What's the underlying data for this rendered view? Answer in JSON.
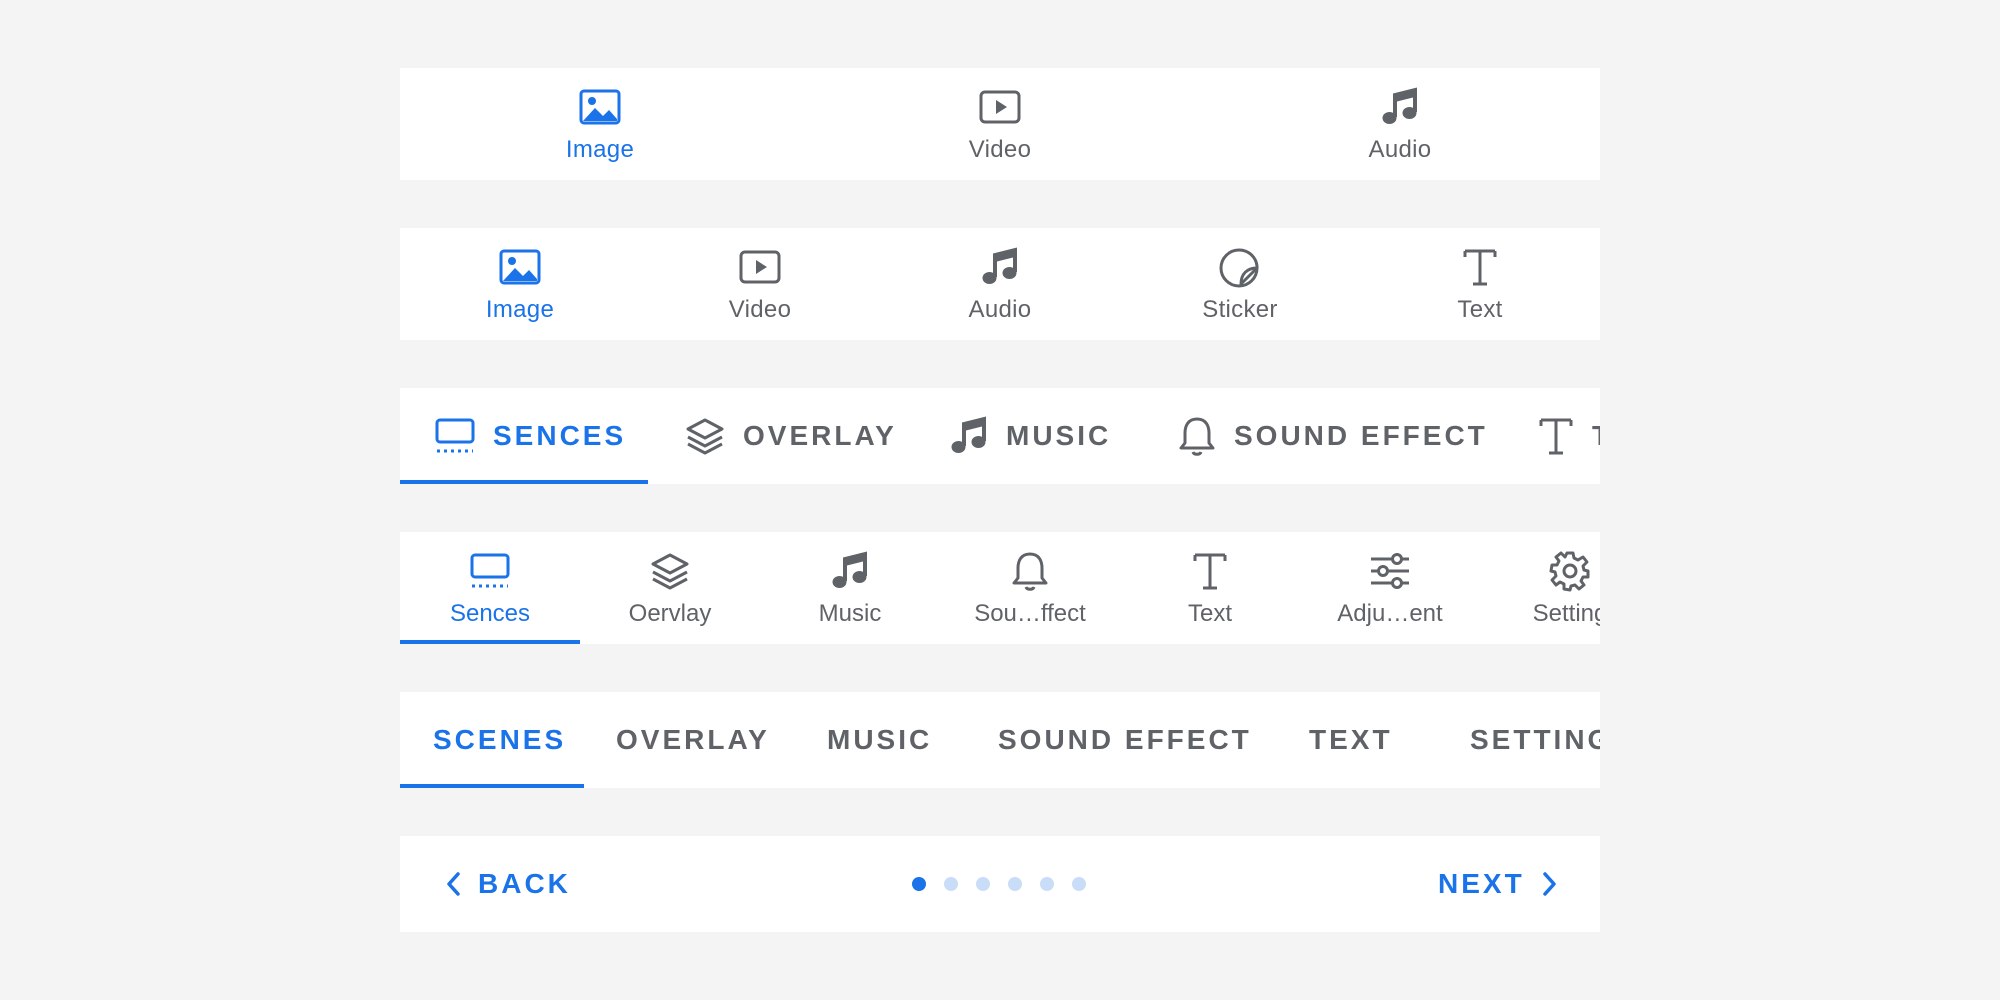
{
  "colors": {
    "accent": "#1a73e8",
    "inactive": "#5f6368",
    "dot_inactive": "#c9dcf8",
    "background": "#f4f4f4",
    "surface": "#ffffff"
  },
  "bottom_nav_3": {
    "items": [
      {
        "label": "Image",
        "icon": "image-icon",
        "active": true
      },
      {
        "label": "Video",
        "icon": "video-icon",
        "active": false
      },
      {
        "label": "Audio",
        "icon": "music-note-icon",
        "active": false
      }
    ]
  },
  "bottom_nav_5": {
    "items": [
      {
        "label": "Image",
        "icon": "image-icon",
        "active": true
      },
      {
        "label": "Video",
        "icon": "video-icon",
        "active": false
      },
      {
        "label": "Audio",
        "icon": "music-note-icon",
        "active": false
      },
      {
        "label": "Sticker",
        "icon": "sticker-icon",
        "active": false
      },
      {
        "label": "Text",
        "icon": "text-icon",
        "active": false
      }
    ]
  },
  "icon_tabs_inline": {
    "items": [
      {
        "label": "SENCES",
        "icon": "scenes-icon",
        "active": true
      },
      {
        "label": "OVERLAY",
        "icon": "layers-icon",
        "active": false
      },
      {
        "label": "MUSIC",
        "icon": "music-note-icon",
        "active": false
      },
      {
        "label": "SOUND EFFECT",
        "icon": "bell-icon",
        "active": false
      },
      {
        "label": "T",
        "icon": "text-icon",
        "active": false
      }
    ]
  },
  "icon_tabs_stacked": {
    "items": [
      {
        "label": "Sences",
        "icon": "scenes-icon",
        "active": true
      },
      {
        "label": "Oervlay",
        "icon": "layers-icon",
        "active": false
      },
      {
        "label": "Music",
        "icon": "music-note-icon",
        "active": false
      },
      {
        "label": "Sou…ffect",
        "icon": "bell-icon",
        "active": false
      },
      {
        "label": "Text",
        "icon": "text-icon",
        "active": false
      },
      {
        "label": "Adju…ent",
        "icon": "sliders-icon",
        "active": false
      },
      {
        "label": "Setting",
        "icon": "gear-icon",
        "active": false
      }
    ]
  },
  "text_tabs": {
    "items": [
      {
        "label": "SCENES",
        "active": true
      },
      {
        "label": "OVERLAY",
        "active": false
      },
      {
        "label": "MUSIC",
        "active": false
      },
      {
        "label": "SOUND EFFECT",
        "active": false
      },
      {
        "label": "TEXT",
        "active": false
      },
      {
        "label": "SETTING",
        "active": false
      }
    ]
  },
  "stepper": {
    "back_label": "BACK",
    "next_label": "NEXT",
    "total_steps": 6,
    "current_step": 1
  }
}
